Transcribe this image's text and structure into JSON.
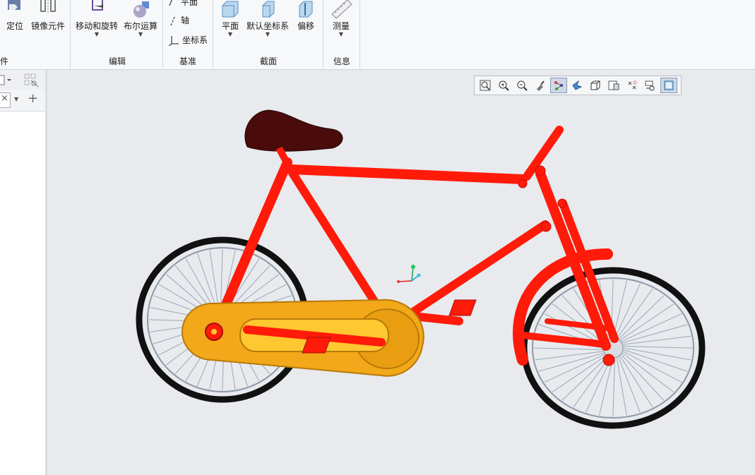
{
  "ribbon": {
    "buttons": {
      "locate": "定位",
      "mirror": "镜像元件",
      "move_rotate": "移动和旋转",
      "boolean": "布尔运算",
      "plane_small": "平面",
      "axis": "轴",
      "csys": "坐标系",
      "plane": "平面",
      "default_csys": "默认坐标系",
      "offset": "偏移",
      "measure": "测量"
    },
    "groups": {
      "component_partial": "件",
      "edit": "编辑",
      "datum": "基准",
      "section": "截面",
      "info": "信息"
    }
  },
  "model_tree": {
    "close_glyph": "×",
    "add_glyph": "+"
  },
  "view_toolbar": {
    "tools": [
      "refit-icon",
      "zoom-in-icon",
      "zoom-out-icon",
      "repaint-icon",
      "datum-display-icon",
      "spin-center-icon",
      "display-style-icon",
      "saved-views-icon",
      "annotation-display-icon",
      "appearance-icon",
      "shading-icon"
    ],
    "active_index": 4
  },
  "model": {
    "frame_color": "#ff1a0a",
    "chainguard_color": "#f2a818",
    "saddle_color": "#4a0b0b",
    "tire_color": "#111111",
    "spoke_color": "#9aa7b6"
  }
}
